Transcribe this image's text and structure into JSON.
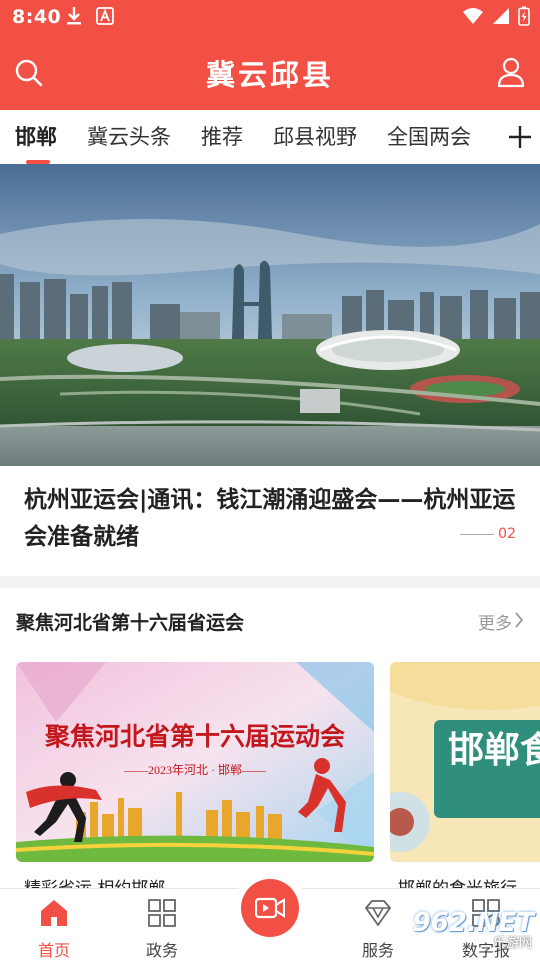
{
  "status_bar": {
    "time": "8:40"
  },
  "header": {
    "title": "冀云邱县"
  },
  "tabs": [
    {
      "label": "邯郸",
      "active": true
    },
    {
      "label": "冀云头条"
    },
    {
      "label": "推荐"
    },
    {
      "label": "邱县视野"
    },
    {
      "label": "全国两会"
    }
  ],
  "banner": {
    "title": "杭州亚运会|通讯：钱江潮涌迎盛会——杭州亚运会准备就绪",
    "slide_number": "02"
  },
  "section": {
    "title": "聚焦河北省第十六届省运会",
    "more_label": "更多",
    "cards": [
      {
        "poster_title": "聚焦河北省第十六届运动会",
        "poster_subtitle": "——2023年河北 · 邯郸——",
        "caption": "精彩省运 相约邯郸"
      },
      {
        "poster_title": "邯郸食光",
        "caption": "邯郸的食光旅行"
      }
    ]
  },
  "bottom_nav": [
    {
      "label": "首页",
      "icon": "home-icon",
      "active": true
    },
    {
      "label": "政务",
      "icon": "grid-icon"
    },
    {
      "label": "",
      "icon": "video-camera-icon"
    },
    {
      "label": "服务",
      "icon": "diamond-icon"
    },
    {
      "label": "数字报",
      "icon": "apps-icon"
    }
  ],
  "watermark": {
    "text": "962.NET",
    "sub": "乐游网"
  },
  "colors": {
    "accent": "#f24f45"
  }
}
